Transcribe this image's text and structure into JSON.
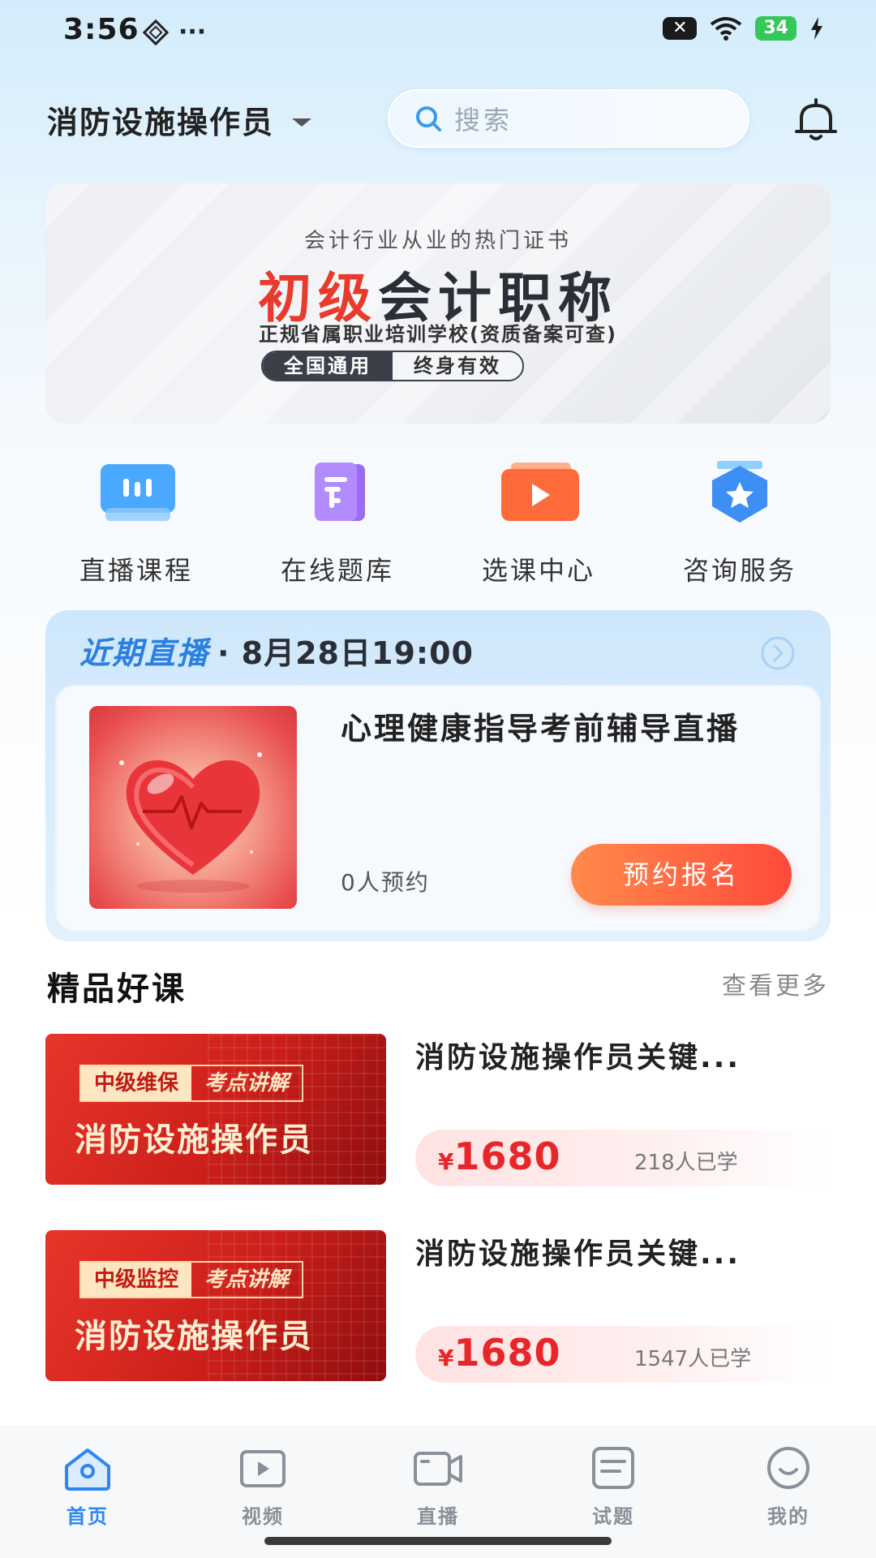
{
  "status_bar": {
    "time": "3:56",
    "dots": "···",
    "sim": "✕",
    "battery": "34"
  },
  "header": {
    "job_title": "消防设施操作员",
    "search_placeholder": "搜索"
  },
  "banner": {
    "subtitle_top": "会计行业从业的热门证书",
    "title_red": "初级",
    "title_dark": "会计职称",
    "subtitle_bottom": "正规省属职业培训学校(资质备案可查)",
    "tag1": "全国通用",
    "tag2": "终身有效"
  },
  "quick_entries": [
    {
      "label": "直播课程",
      "icon": "live-course-icon"
    },
    {
      "label": "在线题库",
      "icon": "question-bank-icon"
    },
    {
      "label": "选课中心",
      "icon": "course-center-icon"
    },
    {
      "label": "咨询服务",
      "icon": "consult-service-icon"
    }
  ],
  "live": {
    "tag": "近期直播",
    "time": "· 8月28日19:00",
    "title": "心理健康指导考前辅导直播",
    "count": "0人预约",
    "button": "预约报名"
  },
  "section": {
    "title": "精品好课",
    "more": "查看更多"
  },
  "courses": [
    {
      "tag1": "中级维保",
      "tag2": "考点讲解",
      "thumb_title": "消防设施操作员",
      "title": "消防设施操作员关键...",
      "currency": "¥",
      "price": "1680",
      "learners": "218人已学"
    },
    {
      "tag1": "中级监控",
      "tag2": "考点讲解",
      "thumb_title": "消防设施操作员",
      "title": "消防设施操作员关键...",
      "currency": "¥",
      "price": "1680",
      "learners": "1547人已学"
    }
  ],
  "nav": [
    {
      "label": "首页",
      "icon": "home-icon",
      "active": true
    },
    {
      "label": "视频",
      "icon": "video-icon",
      "active": false
    },
    {
      "label": "直播",
      "icon": "live-camera-icon",
      "active": false
    },
    {
      "label": "试题",
      "icon": "exam-icon",
      "active": false
    },
    {
      "label": "我的",
      "icon": "profile-icon",
      "active": false
    }
  ],
  "colors": {
    "accent": "#2f86f0",
    "price": "#e8262a",
    "button_start": "#ff8a4c",
    "button_end": "#ff4a3a"
  }
}
